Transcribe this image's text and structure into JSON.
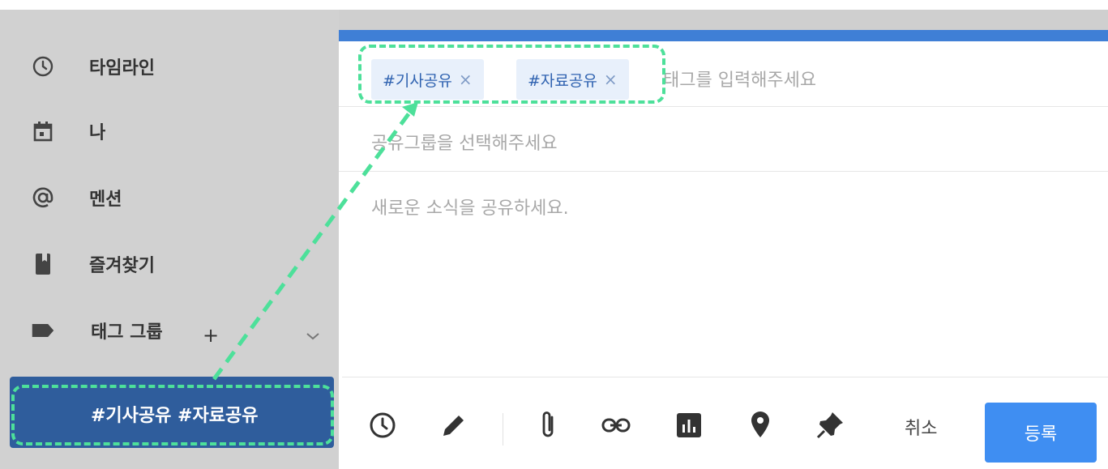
{
  "sidebar": {
    "items": [
      {
        "label": "타임라인",
        "icon": "clock-icon"
      },
      {
        "label": "나",
        "icon": "calendar-icon"
      },
      {
        "label": "멘션",
        "icon": "at-icon"
      },
      {
        "label": "즐겨찾기",
        "icon": "bookmark-icon"
      }
    ],
    "tag_group": {
      "label": "태그 그룹",
      "add": "+",
      "icon": "tag-icon"
    },
    "tag_selected": "#기사공유 #자료공유"
  },
  "composer": {
    "tags": [
      {
        "label": "#기사공유",
        "remove": "×"
      },
      {
        "label": "#자료공유",
        "remove": "×"
      }
    ],
    "tag_placeholder": "태그를 입력해주세요",
    "group_placeholder": "공유그룹을 선택해주세요",
    "content_placeholder": "새로운 소식을 공유하세요.",
    "toolbar_icons": [
      "clock-icon",
      "pencil-icon",
      "paperclip-icon",
      "link-icon",
      "chart-icon",
      "location-icon",
      "pin-icon"
    ],
    "cancel_label": "취소",
    "submit_label": "등록"
  },
  "colors": {
    "accent": "#3f7fd6",
    "highlight": "#4de09a",
    "selected_row": "#2f5d9c",
    "submit_button": "#3f8ef2"
  }
}
